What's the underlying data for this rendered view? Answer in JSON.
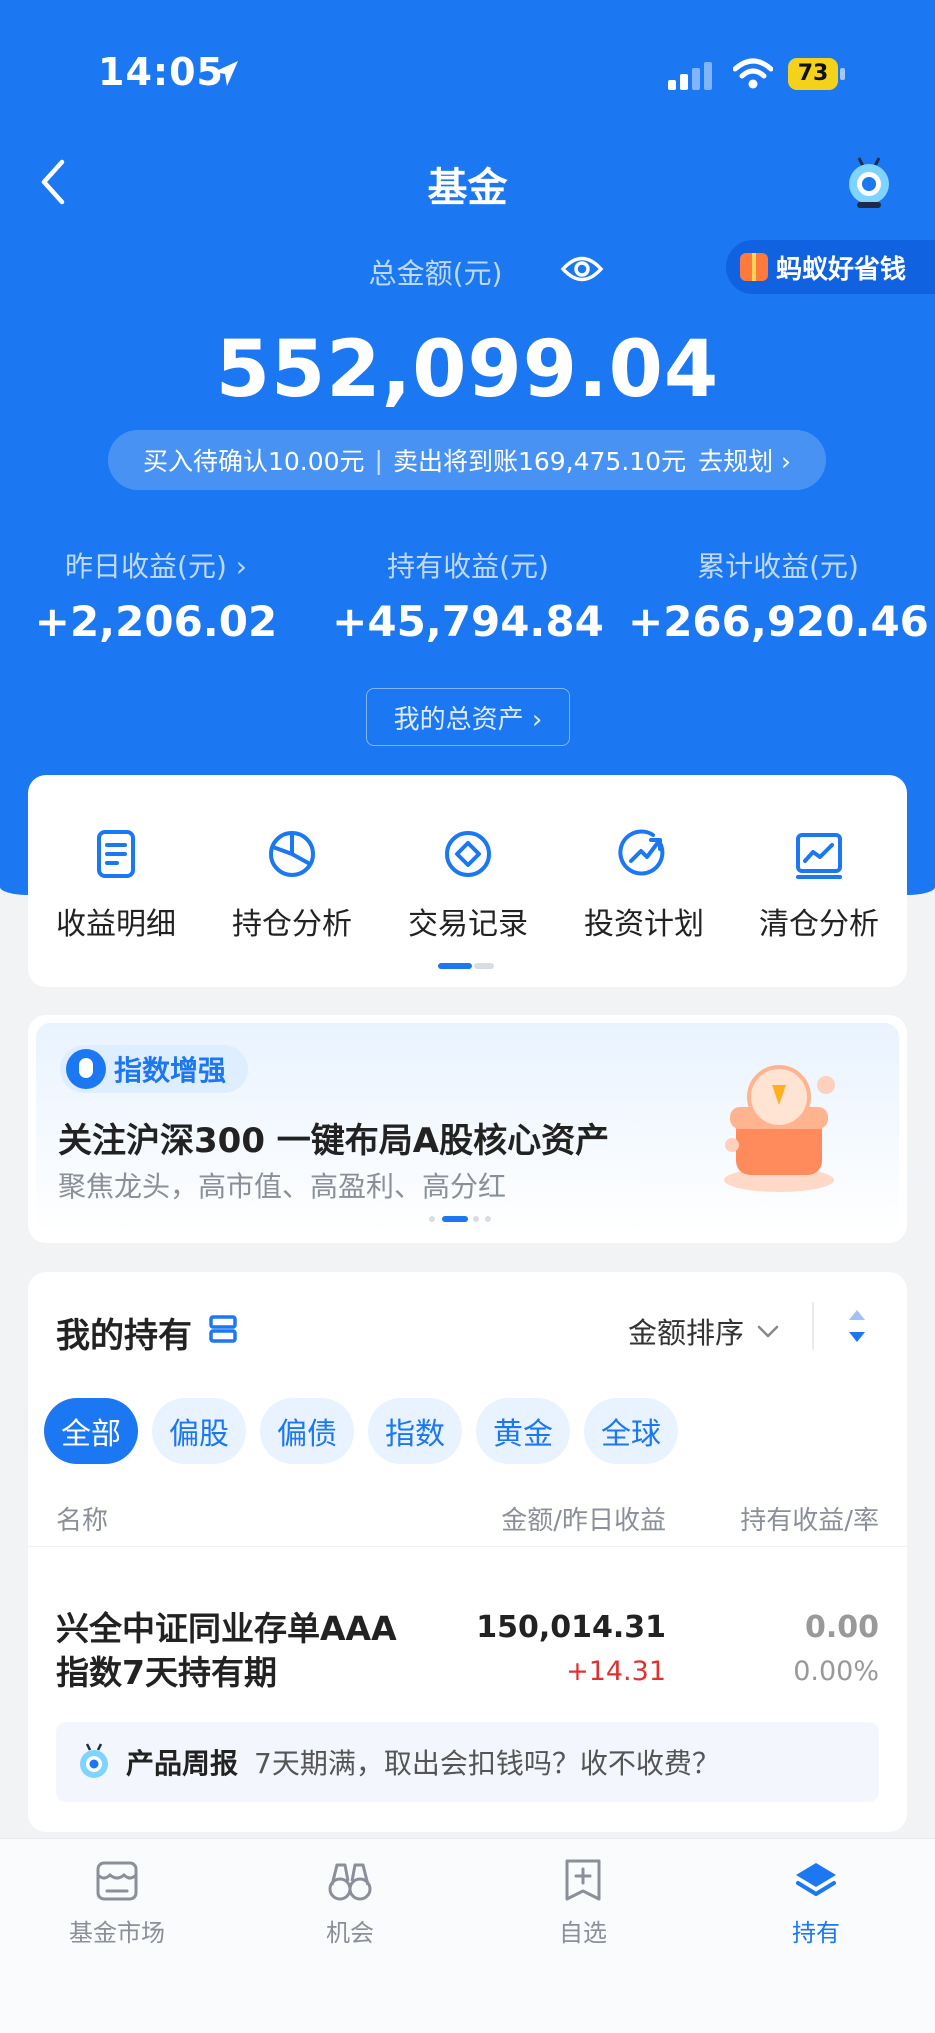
{
  "status_bar": {
    "time": "14:05",
    "battery": "73"
  },
  "nav": {
    "title": "基金",
    "promo": "蚂蚁好省钱"
  },
  "summary": {
    "total_label": "总金额(元)",
    "total_amount": "552,099.04",
    "pending_buy": "买入待确认10.00元",
    "pending_sell": "卖出将到账169,475.10元",
    "plan_link": "去规划 ›"
  },
  "stats": [
    {
      "label": "昨日收益(元) ›",
      "value": "+2,206.02"
    },
    {
      "label": "持有收益(元)",
      "value": "+45,794.84"
    },
    {
      "label": "累计收益(元)",
      "value": "+266,920.46"
    }
  ],
  "assets_button": "我的总资产 ›",
  "functions": [
    {
      "label": "收益明细",
      "icon": "document-icon"
    },
    {
      "label": "持仓分析",
      "icon": "pie-chart-icon"
    },
    {
      "label": "交易记录",
      "icon": "diamond-circle-icon"
    },
    {
      "label": "投资计划",
      "icon": "trend-up-icon"
    },
    {
      "label": "清仓分析",
      "icon": "line-chart-icon"
    }
  ],
  "banner": {
    "tag": "指数增强",
    "title": "关注沪深300 一键布局A股核心资产",
    "subtitle": "聚焦龙头，高市值、高盈利、高分红"
  },
  "holdings": {
    "title": "我的持有",
    "sort_label": "金额排序",
    "filters": [
      "全部",
      "偏股",
      "偏债",
      "指数",
      "黄金",
      "全球"
    ],
    "columns": [
      "名称",
      "金额/昨日收益",
      "持有收益/率"
    ],
    "funds": [
      {
        "name_line1": "兴全中证同业存单AAA",
        "name_line2": "指数7天持有期",
        "amount": "150,014.31",
        "day_gain": "+14.31",
        "hold_gain": "0.00",
        "hold_rate": "0.00%"
      }
    ],
    "report": {
      "title": "产品周报",
      "text": "7天期满，取出会扣钱吗？收不收费？"
    }
  },
  "tabs": [
    {
      "label": "基金市场",
      "icon": "market-icon"
    },
    {
      "label": "机会",
      "icon": "binoculars-icon"
    },
    {
      "label": "自选",
      "icon": "add-favorite-icon"
    },
    {
      "label": "持有",
      "icon": "layers-icon",
      "active": true
    }
  ],
  "colors": {
    "brand_blue": "#1b77f2",
    "gain_red": "#e03131"
  }
}
